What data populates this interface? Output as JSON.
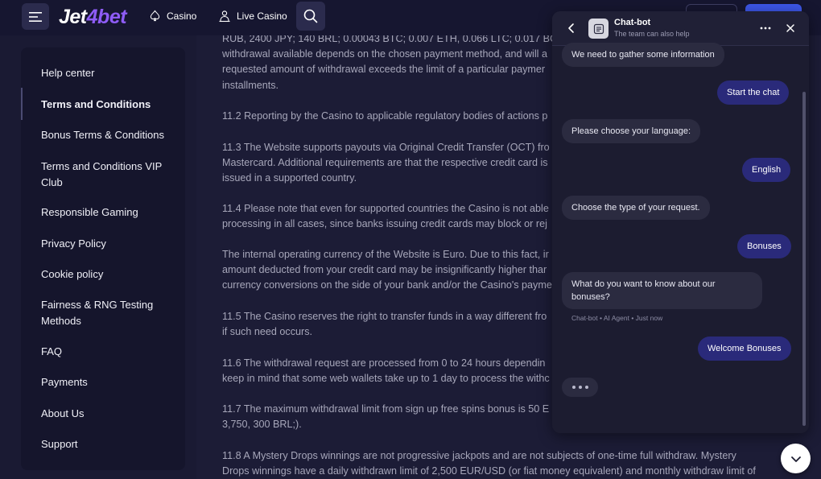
{
  "header": {
    "logo_main": "Jet",
    "logo_accent": "4bet",
    "nav": [
      {
        "label": "Casino",
        "icon": "spade-icon"
      },
      {
        "label": "Live Casino",
        "icon": "dealer-icon"
      }
    ]
  },
  "sidebar": {
    "items": [
      {
        "label": "Help center",
        "active": false
      },
      {
        "label": "Terms and Conditions",
        "active": true
      },
      {
        "label": "Bonus Terms & Conditions",
        "active": false
      },
      {
        "label": "Terms and Conditions VIP Club",
        "active": false
      },
      {
        "label": "Responsible Gaming",
        "active": false
      },
      {
        "label": "Privacy Policy",
        "active": false
      },
      {
        "label": "Cookie policy",
        "active": false
      },
      {
        "label": "Fairness & RNG Testing Methods",
        "active": false
      },
      {
        "label": "FAQ",
        "active": false
      },
      {
        "label": "Payments",
        "active": false
      },
      {
        "label": "About Us",
        "active": false
      },
      {
        "label": "Support",
        "active": false
      }
    ]
  },
  "content": {
    "paragraphs": [
      [
        "RUB, 2400 JPY; 140 BRL; 0.00043 BTC; 0.007 ETH, 0.066 LTC; 0.017 BCH",
        "withdrawal available depends on the chosen payment method, and will a",
        "requested amount of withdrawal exceeds the limit of a particular paymer",
        "installments."
      ],
      [
        "11.2 Reporting by the Casino to applicable regulatory bodies of actions p"
      ],
      [
        "11.3 The Website supports payouts via Original Credit Transfer (OCT) fro",
        "Mastercard. Additional requirements are that the respective credit card is",
        "issued in a supported country."
      ],
      [
        "11.4 Please note that even for supported countries the Casino is not able",
        "processing in all cases, since banks issuing credit cards may block or rej"
      ],
      [
        "The internal operating currency of the Website is Euro. Due to this fact, ir",
        "amount deducted from your credit card may be insignificantly higher thar",
        "currency conversions on the side of your bank and/or the Casino's payme"
      ],
      [
        "11.5 The Casino reserves the right to transfer funds in a way different fro",
        "if such need occurs."
      ],
      [
        "11.6 The withdrawal request are processed from 0 to 24 hours dependin",
        "keep in mind that some web wallets take up to 1 day to process the withc"
      ],
      [
        "11.7 The maximum withdrawal limit from sign up free spins bonus is 50 E",
        "3,750, 300 BRL;)."
      ],
      [
        "11.8 A Mystery Drops winnings are not progressive jackpots and are not subjects of one-time full withdraw. Mystery",
        "Drops winnings have a daily withdrawn limit of 2,500 EUR/USD (or fiat money equivalent) and monthly withdraw limit of"
      ]
    ]
  },
  "chat": {
    "title": "Chat-bot",
    "subtitle": "The team can also help",
    "messages": [
      {
        "from": "bot",
        "text": "We need to gather some information"
      },
      {
        "from": "user",
        "text": "Start the chat"
      },
      {
        "from": "bot",
        "text": "Please choose your language:"
      },
      {
        "from": "user",
        "text": "English"
      },
      {
        "from": "bot",
        "text": "Choose the type of your request."
      },
      {
        "from": "user",
        "text": "Bonuses"
      },
      {
        "from": "bot",
        "text": "What do you want to know about our bonuses?"
      },
      {
        "from": "user",
        "text": "Welcome Bonuses"
      }
    ],
    "meta": "Chat-bot • AI Agent • Just now"
  }
}
